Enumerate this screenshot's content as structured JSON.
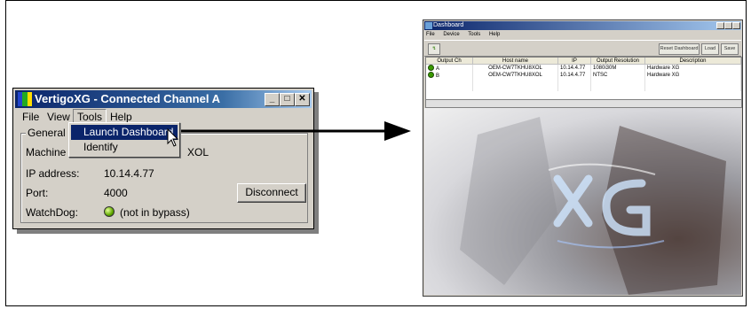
{
  "vertigo": {
    "title": "VertigoXG - Connected Channel A",
    "menu": [
      "File",
      "View",
      "Tools",
      "Help"
    ],
    "group_label": "General Ir",
    "fields": {
      "machine_label": "Machine r",
      "machine_value": "XOL",
      "ip_label": "IP address:",
      "ip_value": "10.14.4.77",
      "port_label": "Port:",
      "port_value": "4000",
      "watchdog_label": "WatchDog:",
      "watchdog_value": "(not in bypass)"
    },
    "disconnect_label": "Disconnect",
    "dropdown": [
      "Launch Dashboard",
      "Identify"
    ]
  },
  "dashboard": {
    "title": "Dashboard",
    "menu": [
      "File",
      "Device",
      "Tools",
      "Help"
    ],
    "buttons": [
      "Reset Dashboard",
      "Load",
      "Save"
    ],
    "columns": [
      "Output Ch",
      "Host name",
      "IP",
      "Output Resolution",
      "Description"
    ],
    "rows": [
      [
        "A",
        "OEM-CW7TKHU8XOL",
        "10.14.4.77",
        "1080i30M",
        "Hardware XG"
      ],
      [
        "B",
        "OEM-CW7TKHU8XOL",
        "10.14.4.77",
        "NTSC",
        "Hardware XG"
      ]
    ]
  },
  "colors": {
    "titlebar": "#0a246a",
    "menu_highlight": "#0a246a",
    "led_green": "#5fa800"
  }
}
